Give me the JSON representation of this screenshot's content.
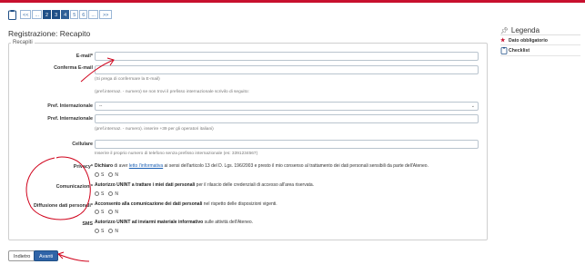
{
  "steps": {
    "items": [
      "<<",
      "...",
      "2",
      "3",
      "4",
      "5",
      "6",
      "...",
      ">>"
    ],
    "states": [
      "link",
      "link",
      "done",
      "done",
      "current",
      "link",
      "link",
      "link",
      "link"
    ]
  },
  "page": {
    "title": "Registrazione: Recapito"
  },
  "form": {
    "legend": "Recapiti",
    "email_label": "E-mail*",
    "confirm_label": "Conferma E-mail",
    "confirm_hint": "(Si prega di confermare la E-mail)",
    "phone_intro": "(pref.internaz. - numero) se non trovi il prefisso internazionale scrivilo di seguito:",
    "intl_prefix_label": "Pref. Internazionale",
    "intl_prefix_select_value": "--",
    "intl_prefix2_label": "Pref. Internazionale",
    "phone_hint": "(pref.internaz. - numero). inserire +39 per gli operatori italiani)",
    "mobile_label": "Cellulare",
    "mobile_hint": "Inserire il proprio numero di telefono senza prefisso internazionale (es: 3391234567)",
    "privacy_label": "Privacy*",
    "privacy_text_pre": "Dichiaro",
    "privacy_text_mid": " di aver ",
    "privacy_link": "letto l'informativa",
    "privacy_text_post": " ai sensi dell'articolo 13 del D. Lgs. 196/2003 e presto il mio consenso al trattamento dei dati personali sensibili da parte dell'Ateneo.",
    "comm_label": "Comunicazioni*",
    "comm_text_bold": "Autorizzo UNINT a trattare i miei dati personali",
    "comm_text_rest": " per il rilascio delle credenziali di accesso all'area riservata.",
    "diff_label": "Diffusione dati personali*",
    "diff_text_bold": "Acconsento alla comunicazione dei dati personali",
    "diff_text_rest": " nel rispetto delle disposizioni vigenti.",
    "sms_label": "SMS",
    "sms_text_bold": "Autorizzo UNINT ad inviarmi materiale informativo",
    "sms_text_rest": " sulle attività dell'Ateneo.",
    "yes": "S",
    "no": "N"
  },
  "buttons": {
    "back": "Indietro",
    "next": "Avanti"
  },
  "legend": {
    "title": "Legenda",
    "required": "Dato obbligatorio",
    "checklist": "Checklist"
  },
  "colors": {
    "accent": "#2f64a8",
    "brand_red": "#c8102e",
    "annotation": "#d0021b"
  }
}
